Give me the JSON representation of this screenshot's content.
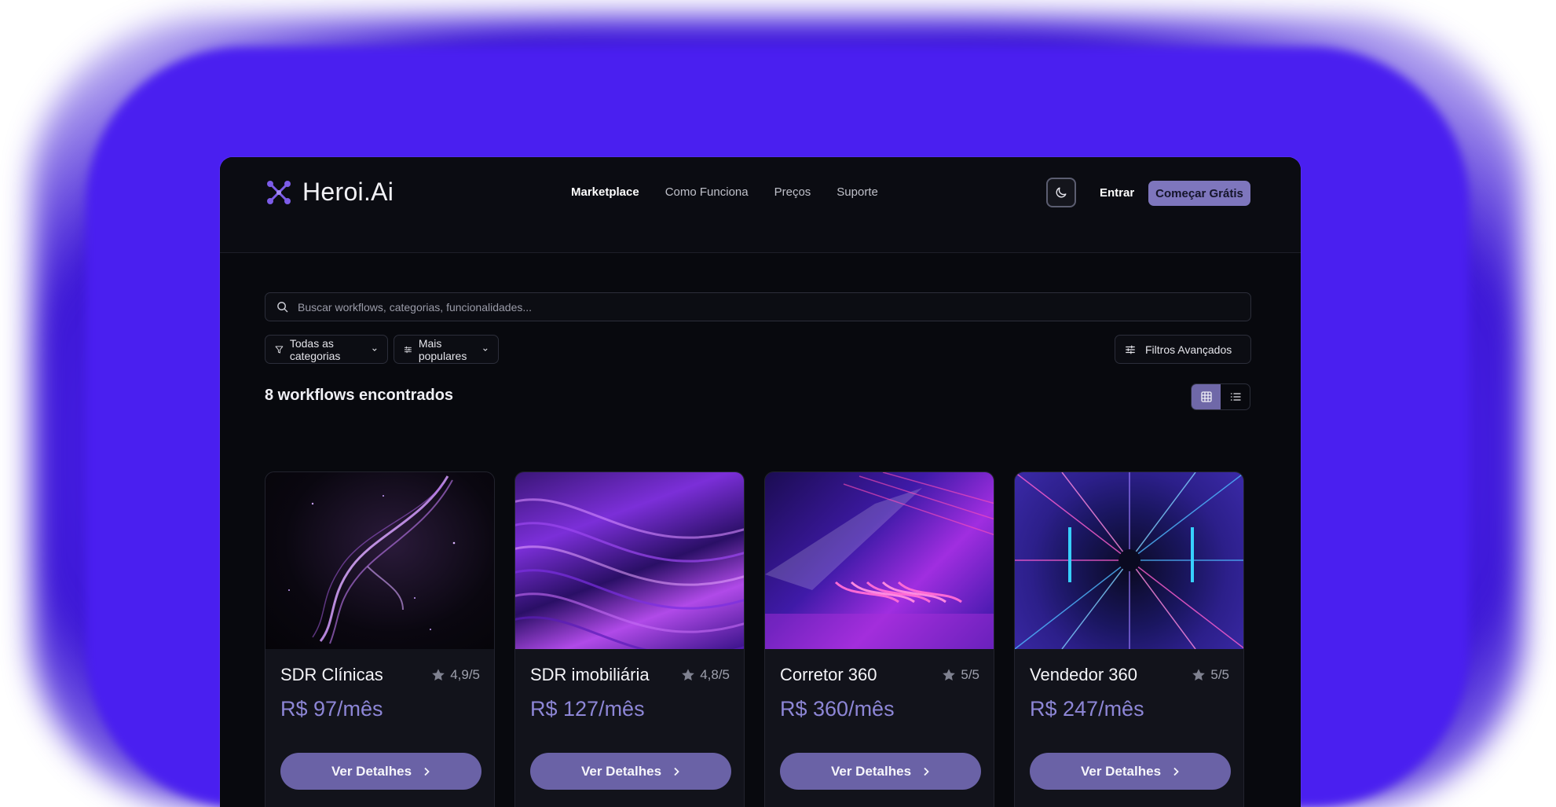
{
  "brand": {
    "name": "Heroi.Ai",
    "accent": "#7e76bd",
    "glow": "#4a1ff0"
  },
  "nav": {
    "items": [
      {
        "label": "Marketplace",
        "active": true
      },
      {
        "label": "Como Funciona",
        "active": false
      },
      {
        "label": "Preços",
        "active": false
      },
      {
        "label": "Suporte",
        "active": false
      }
    ],
    "theme_icon": "moon-icon",
    "login_label": "Entrar",
    "cta_label": "Começar Grátis"
  },
  "search": {
    "placeholder": "Buscar workflows, categorias, funcionalidades..."
  },
  "filters": {
    "category_label": "Todas as categorias",
    "sort_label": "Mais populares",
    "advanced_label": "Filtros Avançados"
  },
  "results": {
    "count_label": "8 workflows encontrados",
    "view": "grid"
  },
  "cards": [
    {
      "title": "SDR Clínicas",
      "rating": "4,9/5",
      "price": "R$ 97/mês",
      "button_label": "Ver Detalhes"
    },
    {
      "title": "SDR imobiliária",
      "rating": "4,8/5",
      "price": "R$ 127/mês",
      "button_label": "Ver Detalhes"
    },
    {
      "title": "Corretor 360",
      "rating": "5/5",
      "price": "R$ 360/mês",
      "button_label": "Ver Detalhes"
    },
    {
      "title": "Vendedor 360",
      "rating": "5/5",
      "price": "R$ 247/mês",
      "button_label": "Ver Detalhes"
    }
  ]
}
